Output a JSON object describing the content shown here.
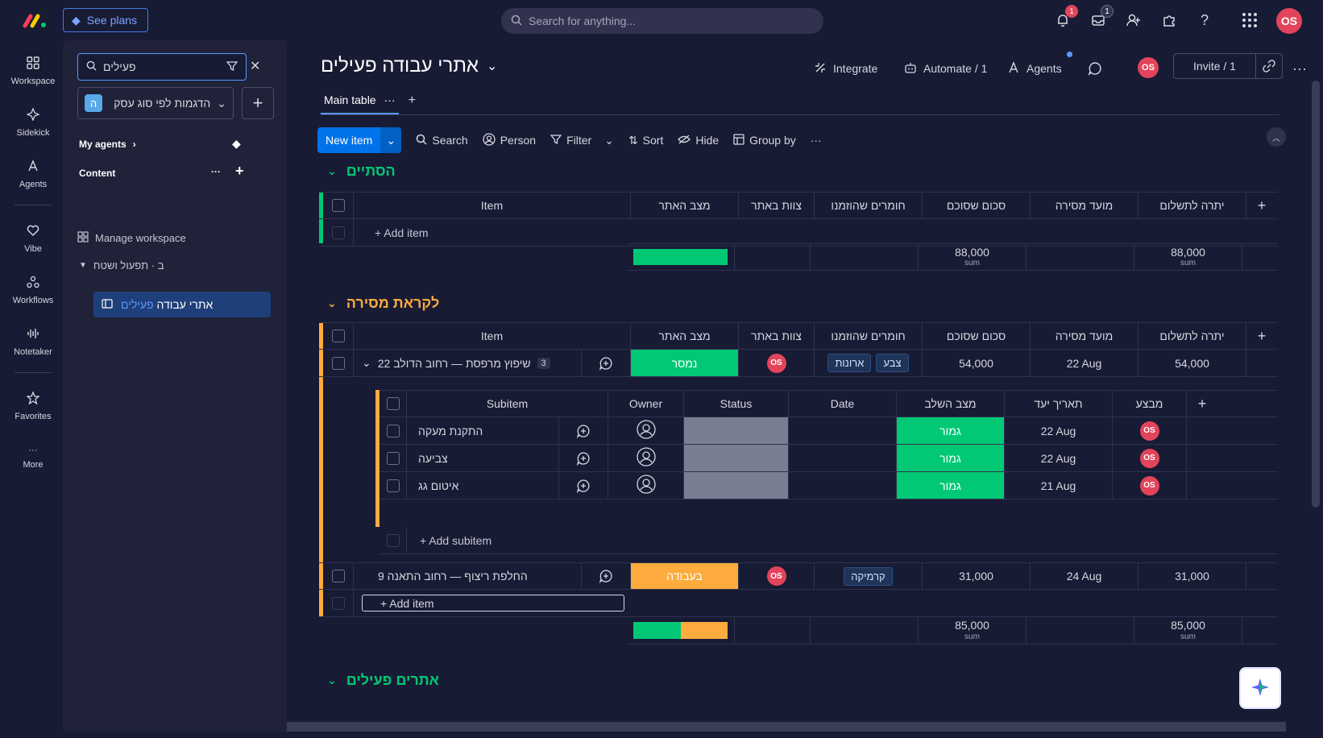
{
  "topbar": {
    "see_plans": "See plans",
    "search_placeholder": "Search for anything...",
    "notifications_badge": "1",
    "inbox_badge": "1",
    "user_initials": "OS"
  },
  "rail": {
    "items": [
      {
        "label": "Workspace",
        "icon": "grid-icon"
      },
      {
        "label": "Sidekick",
        "icon": "sparkle-icon"
      },
      {
        "label": "Agents",
        "icon": "agent-icon"
      },
      {
        "label": "Vibe",
        "icon": "heart-icon"
      },
      {
        "label": "Workflows",
        "icon": "workflow-icon"
      },
      {
        "label": "Notetaker",
        "icon": "waveform-icon"
      },
      {
        "label": "Favorites",
        "icon": "star-icon"
      },
      {
        "label": "More",
        "icon": "dots-icon"
      }
    ]
  },
  "sidepanel": {
    "search_value": "פעילים",
    "workspace_letter": "ה",
    "workspace_name": "הדגמות לפי סוג עסק",
    "my_agents": "My agents",
    "content": "Content",
    "manage_workspace": "Manage workspace",
    "folder": "ב · תפעול ושטח",
    "board_prefix": "אתרי עבודה ",
    "board_highlight": "פעילים"
  },
  "board": {
    "title": "אתרי עבודה פעילים",
    "integrate": "Integrate",
    "automate": "Automate / 1",
    "agents": "Agents",
    "invite": "Invite / 1",
    "tab_main": "Main table",
    "toolbar": {
      "new_item": "New item",
      "search": "Search",
      "person": "Person",
      "filter": "Filter",
      "sort": "Sort",
      "hide": "Hide",
      "group_by": "Group by"
    },
    "columns": [
      "Item",
      "מצב האתר",
      "צוות באתר",
      "חומרים שהוזמנו",
      "סכום שסוכם",
      "מועד מסירה",
      "יתרה לתשלום"
    ],
    "add_item": "+ Add item",
    "sum_label": "sum",
    "groups": [
      {
        "title": "הסתיים",
        "color": "#00c875",
        "sum_total": "88,000",
        "sum_balance": "88,000"
      },
      {
        "title": "לקראת מסירה",
        "color": "#fdab3d",
        "sum_total": "85,000",
        "sum_balance": "85,000",
        "items": [
          {
            "name": "שיפוץ מרפסת — רחוב הדולב 22",
            "subitems_count": "3",
            "status": "נמסר",
            "status_color": "#00c875",
            "team": "OS",
            "materials": [
              "צבע",
              "ארונות"
            ],
            "total": "54,000",
            "delivery": "22 Aug",
            "balance": "54,000"
          },
          {
            "name": "החלפת ריצוף — רחוב התאנה 9",
            "status": "בעבודה",
            "status_color": "#fdab3d",
            "team": "OS",
            "materials": [
              "קרמיקה"
            ],
            "total": "31,000",
            "delivery": "24 Aug",
            "balance": "31,000"
          }
        ]
      },
      {
        "title": "אתרים פעילים",
        "color": "#00c875"
      }
    ],
    "subitems": {
      "columns": [
        "Subitem",
        "Owner",
        "Status",
        "Date",
        "מצב השלב",
        "תאריך יעד",
        "מבצע"
      ],
      "rows": [
        {
          "name": "התקנת מעקה",
          "stage": "גמור",
          "due": "22 Aug",
          "by": "OS"
        },
        {
          "name": "צביעה",
          "stage": "גמור",
          "due": "22 Aug",
          "by": "OS"
        },
        {
          "name": "איטום גג",
          "stage": "גמור",
          "due": "21 Aug",
          "by": "OS"
        }
      ],
      "add_subitem": "+ Add subitem"
    }
  }
}
